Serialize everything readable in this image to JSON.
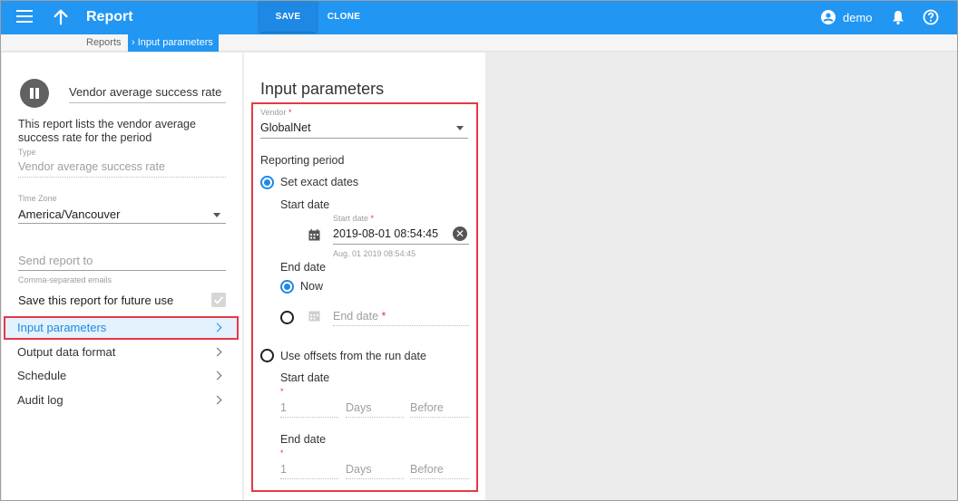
{
  "topbar": {
    "title": "Report",
    "save_label": "SAVE",
    "clone_label": "CLONE",
    "user": "demo",
    "accent": "#2196f3"
  },
  "breadcrumb": {
    "items": [
      "Reports",
      "Input parameters"
    ]
  },
  "left": {
    "report_name": "Vendor average success rate",
    "description": "This report lists the vendor average success rate for the period",
    "type_label": "Type",
    "type_value": "Vendor average success rate",
    "timezone_label": "Time Zone",
    "timezone_value": "America/Vancouver",
    "send_placeholder": "Send report to",
    "send_hint": "Comma-separated emails",
    "save_future_label": "Save this report for future use",
    "nav": [
      {
        "label": "Input parameters"
      },
      {
        "label": "Output data format"
      },
      {
        "label": "Schedule"
      },
      {
        "label": "Audit log"
      }
    ]
  },
  "params": {
    "title": "Input parameters",
    "vendor_label": "Vendor",
    "vendor_value": "GlobalNet",
    "reporting_period": "Reporting period",
    "exact_dates_label": "Set exact dates",
    "start_date_heading": "Start date",
    "start_date_label": "Start date",
    "start_date_value": "2019-08-01 08:54:45",
    "start_date_hint": "Aug. 01 2019 08:54:45",
    "end_date_heading": "End date",
    "now_label": "Now",
    "end_date_placeholder": "End date",
    "offsets_label": "Use offsets from the run date",
    "offset_start_heading": "Start date",
    "offset_start_value": "1",
    "offset_start_unit": "Days",
    "offset_start_dir": "Before",
    "offset_end_heading": "End date",
    "offset_end_value": "1",
    "offset_end_unit": "Days",
    "offset_end_dir": "Before",
    "required_mark": "*"
  }
}
